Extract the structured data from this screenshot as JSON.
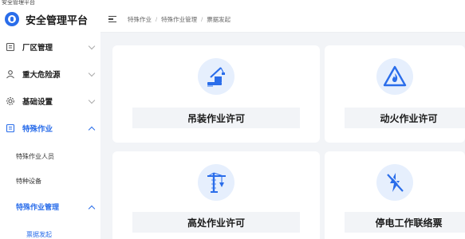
{
  "window": {
    "title": "安全管理平台"
  },
  "app": {
    "name": "安全管理平台"
  },
  "sidebar": {
    "items": [
      {
        "label": "厂区管理",
        "icon": "factory-icon"
      },
      {
        "label": "重大危险源",
        "icon": "user-icon"
      },
      {
        "label": "基础设置",
        "icon": "gear-icon"
      },
      {
        "label": "特殊作业",
        "icon": "document-icon",
        "active": true
      }
    ],
    "subitems": [
      {
        "label": "特殊作业人员"
      },
      {
        "label": "特种设备"
      },
      {
        "label": "特殊作业管理",
        "expanded": true
      }
    ],
    "leaf": {
      "label": "票据发起",
      "selected": true
    }
  },
  "breadcrumb": [
    "特殊作业",
    "特殊作业管理",
    "票据发起"
  ],
  "cards": [
    {
      "label": "吊装作业许可",
      "icon": "crane-icon"
    },
    {
      "label": "动火作业许可",
      "icon": "fire-warning-icon"
    },
    {
      "label": "高处作业许可",
      "icon": "tower-crane-icon"
    },
    {
      "label": "停电工作联络票",
      "icon": "power-off-icon"
    }
  ],
  "colors": {
    "accent": "#2a6dea",
    "background": "#f2f4f7",
    "icon_bg": "#e6effd"
  }
}
